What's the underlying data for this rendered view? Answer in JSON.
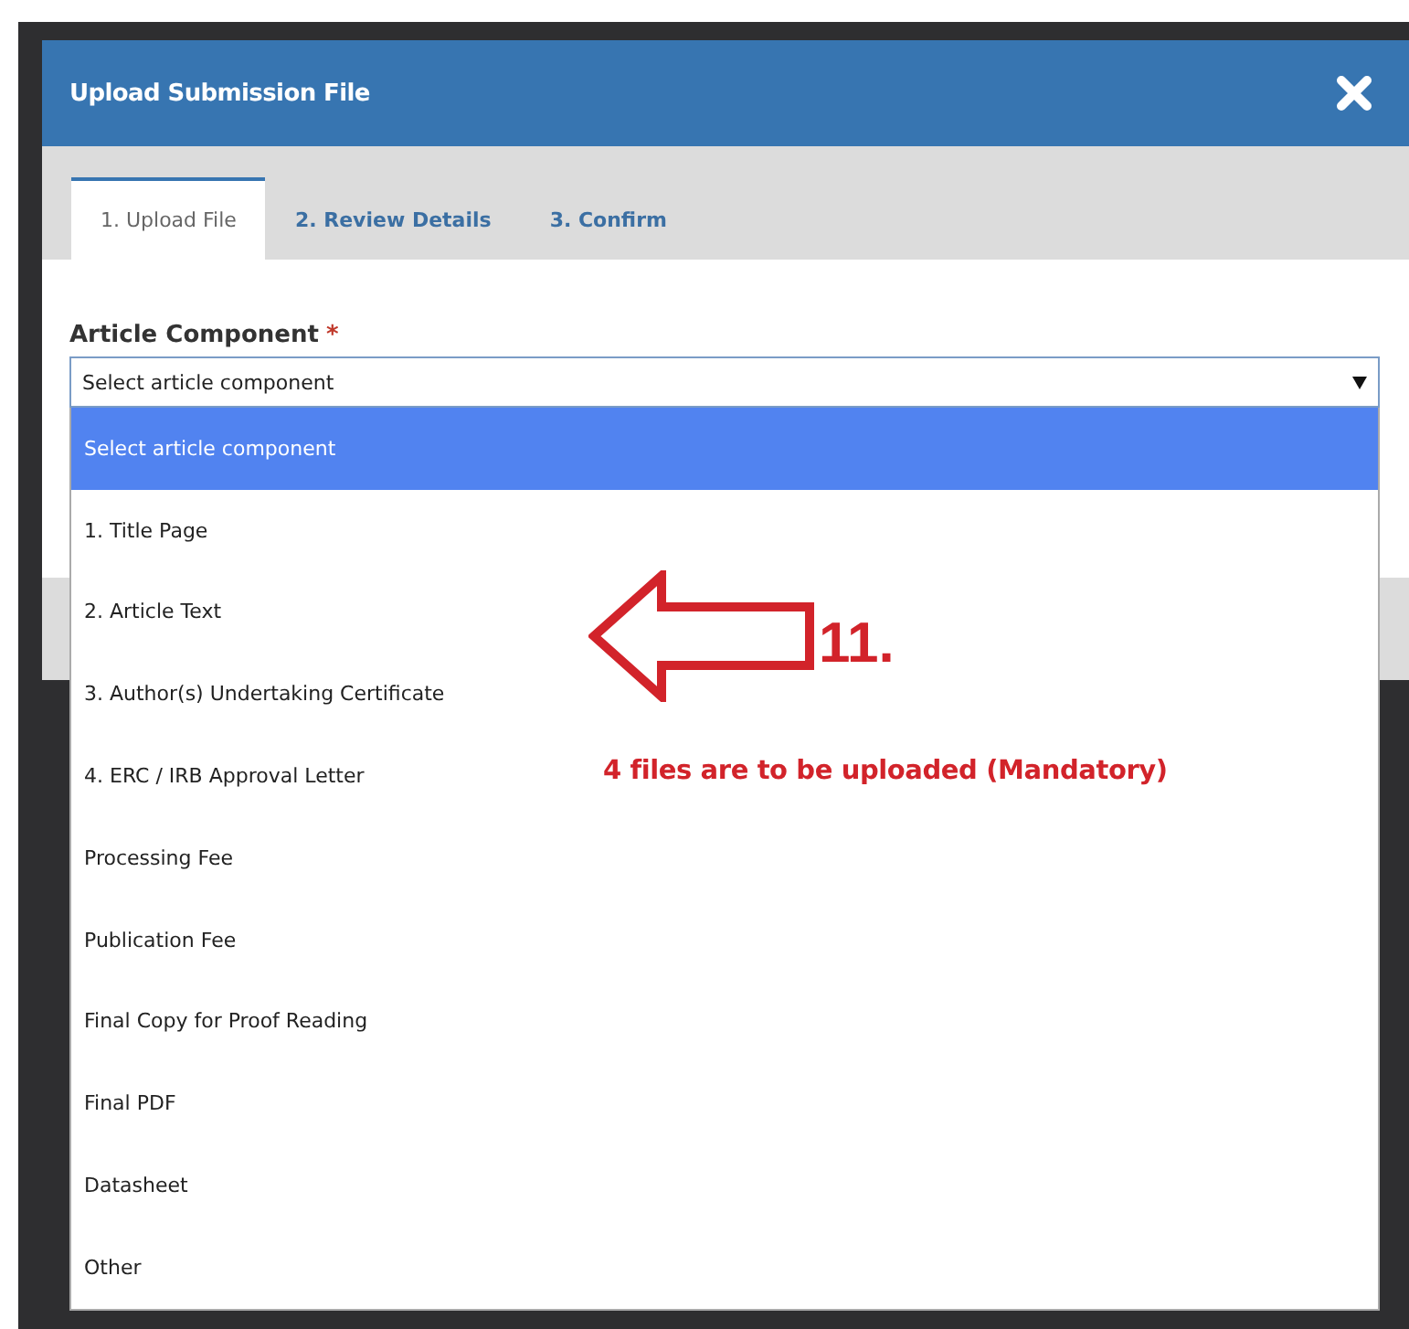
{
  "dialog": {
    "title": "Upload Submission File"
  },
  "tabs": [
    {
      "label": "1. Upload File",
      "selected": true
    },
    {
      "label": "2. Review Details",
      "selected": false
    },
    {
      "label": "3. Confirm",
      "selected": false
    }
  ],
  "field": {
    "label": "Article Component",
    "required_mark": "*",
    "value": "Select article component",
    "expanded": true
  },
  "options": [
    {
      "label": "Select article component",
      "selected": true
    },
    {
      "label": "1. Title Page",
      "selected": false
    },
    {
      "label": "2. Article Text",
      "selected": false
    },
    {
      "label": "3. Author(s) Undertaking Certificate",
      "selected": false
    },
    {
      "label": "4. ERC / IRB Approval Letter",
      "selected": false
    },
    {
      "label": "Processing Fee",
      "selected": false
    },
    {
      "label": "Publication Fee",
      "selected": false
    },
    {
      "label": "Final Copy for Proof Reading",
      "selected": false
    },
    {
      "label": "Final PDF",
      "selected": false
    },
    {
      "label": "Datasheet",
      "selected": false
    },
    {
      "label": "Other",
      "selected": false
    }
  ],
  "annotation": {
    "step": "11.",
    "note": "4 files are to be uploaded (Mandatory)"
  }
}
